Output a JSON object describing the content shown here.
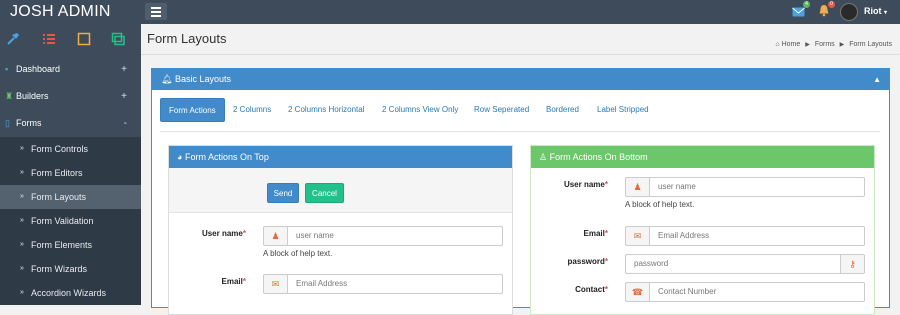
{
  "brand": "JOSH ADMIN",
  "user": "Riot",
  "notifications": {
    "mail_count": "4",
    "alert_count": "0"
  },
  "sidebar": {
    "items": [
      {
        "label": "Dashboard",
        "toggle": "+"
      },
      {
        "label": "Builders",
        "toggle": "+"
      },
      {
        "label": "Forms",
        "toggle": "-"
      }
    ],
    "forms_sub": [
      "Form Controls",
      "Form Editors",
      "Form Layouts",
      "Form Validation",
      "Form Elements",
      "Form Wizards",
      "Accordion Wizards"
    ]
  },
  "page": {
    "title": "Form Layouts"
  },
  "breadcrumb": {
    "home": "Home",
    "forms": "Forms",
    "current": "Form Layouts"
  },
  "panel": {
    "title": "Basic Layouts"
  },
  "tabs": [
    "Form Actions",
    "2 Columns",
    "2 Columns Horizontal",
    "2 Columns View Only",
    "Row Seperated",
    "Bordered",
    "Label Stripped"
  ],
  "left": {
    "title": "Form Actions On Top",
    "send": "Send",
    "cancel": "Cancel",
    "username_label": "User name",
    "username_placeholder": "user name",
    "help": "A block of help text.",
    "email_label": "Email",
    "email_placeholder": "Email Address"
  },
  "right": {
    "title": "Form Actions On Bottom",
    "username_label": "User name",
    "username_placeholder": "user name",
    "help": "A block of help text.",
    "email_label": "Email",
    "email_placeholder": "Email Address",
    "password_label": "password",
    "password_placeholder": "password",
    "contact_label": "Contact",
    "contact_placeholder": "Contact Number"
  },
  "required_mark": "*",
  "colors": {
    "sidebar": "#3e4b5b",
    "primary": "#428bca",
    "success": "#6cc76a",
    "teal": "#22c08a",
    "addon_icon": "#e86a3c"
  }
}
